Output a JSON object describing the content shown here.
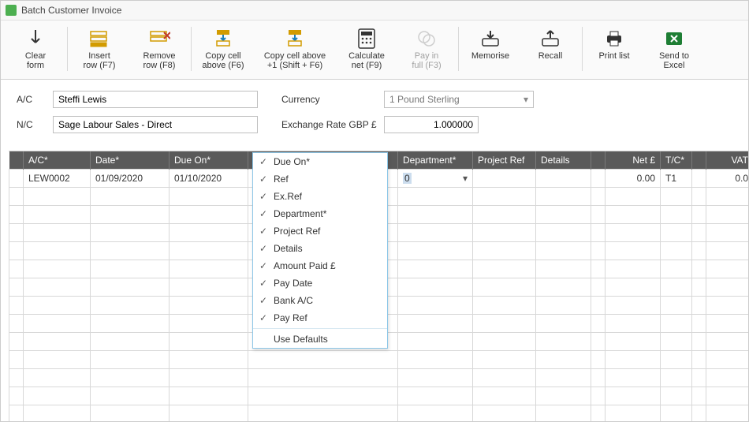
{
  "window": {
    "title": "Batch Customer Invoice"
  },
  "toolbar": {
    "clear": {
      "label": "Clear\nform"
    },
    "insert": {
      "label": "Insert\nrow (F7)"
    },
    "remove": {
      "label": "Remove\nrow (F8)"
    },
    "copyabove": {
      "label": "Copy cell\nabove (F6)"
    },
    "copyplus": {
      "label": "Copy cell above\n+1 (Shift + F6)"
    },
    "calc": {
      "label": "Calculate\nnet (F9)"
    },
    "payin": {
      "label": "Pay in\nfull (F3)"
    },
    "memorise": {
      "label": "Memorise"
    },
    "recall": {
      "label": "Recall"
    },
    "print": {
      "label": "Print list"
    },
    "excel": {
      "label": "Send to\nExcel"
    }
  },
  "form": {
    "ac_label": "A/C",
    "ac_value": "Steffi Lewis",
    "nc_label": "N/C",
    "nc_value": "Sage Labour Sales - Direct",
    "currency_label": "Currency",
    "currency_value": "1  Pound Sterling",
    "exrate_label": "Exchange Rate GBP £",
    "exrate_value": "1.000000"
  },
  "grid": {
    "headers": {
      "ac": "A/C*",
      "date": "Date*",
      "dueon": "Due On*",
      "dept": "Department*",
      "projref": "Project Ref",
      "details": "Details",
      "net": "Net £",
      "tc": "T/C*",
      "vat": "VAT"
    },
    "row": {
      "ac": "LEW0002",
      "date": "01/09/2020",
      "dueon": "01/10/2020",
      "dept": "0",
      "projref": "",
      "details": "",
      "net": "0.00",
      "tc": "T1",
      "vat": "0.0"
    }
  },
  "context_menu": {
    "items": [
      "Due On*",
      "Ref",
      "Ex.Ref",
      "Department*",
      "Project Ref",
      "Details",
      "Amount Paid £",
      "Pay Date",
      "Bank A/C",
      "Pay Ref"
    ],
    "footer": "Use Defaults"
  }
}
